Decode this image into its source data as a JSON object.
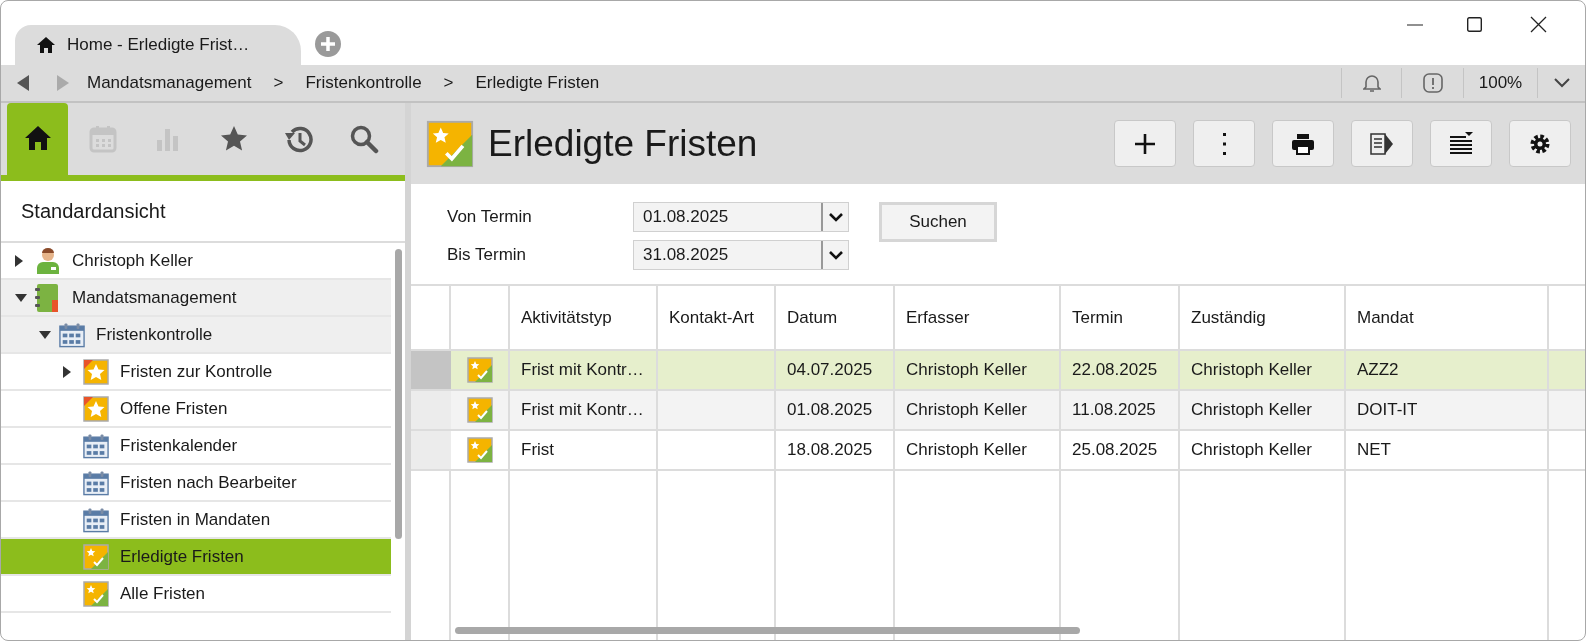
{
  "window": {
    "tab_title": "Home - Erledigte Frist…"
  },
  "breadcrumb": {
    "back_disabled": false,
    "forward_disabled": true,
    "items": [
      "Mandatsmanagement",
      "Fristenkontrolle",
      "Erledigte Fristen"
    ],
    "separator": ">",
    "zoom": "100%"
  },
  "sidebar": {
    "tabs": [
      {
        "kind": "home",
        "selected": true,
        "disabled": false
      },
      {
        "kind": "calendar",
        "selected": false,
        "disabled": true
      },
      {
        "kind": "chart",
        "selected": false,
        "disabled": true
      },
      {
        "kind": "star",
        "selected": false,
        "disabled": false
      },
      {
        "kind": "history",
        "selected": false,
        "disabled": false
      },
      {
        "kind": "search",
        "selected": false,
        "disabled": false
      }
    ],
    "view_title": "Standardansicht",
    "tree": [
      {
        "label": "Christoph Keller",
        "kind": "person",
        "expanded": false,
        "selected": false
      },
      {
        "label": "Mandatsmanagement",
        "kind": "binder",
        "expanded": true,
        "selected": false,
        "children": [
          {
            "label": "Fristenkontrolle",
            "kind": "calendar",
            "expanded": true,
            "selected": false,
            "children": [
              {
                "label": "Fristen zur Kontrolle",
                "kind": "open",
                "expanded": false,
                "selected": false
              },
              {
                "label": "Offene Fristen",
                "kind": "open",
                "selected": false
              },
              {
                "label": "Fristenkalender",
                "kind": "calendar",
                "selected": false
              },
              {
                "label": "Fristen nach Bearbeiter",
                "kind": "calendar",
                "selected": false
              },
              {
                "label": "Fristen in Mandaten",
                "kind": "calendar",
                "selected": false
              },
              {
                "label": "Erledigte Fristen",
                "kind": "done",
                "selected": true
              },
              {
                "label": "Alle Fristen",
                "kind": "done",
                "selected": false
              }
            ]
          }
        ]
      }
    ]
  },
  "main": {
    "title": "Erledigte Fristen",
    "toolbar": [
      {
        "kind": "plus"
      },
      {
        "kind": "more"
      },
      {
        "kind": "print"
      },
      {
        "kind": "panel"
      },
      {
        "kind": "list"
      },
      {
        "kind": "settings"
      }
    ],
    "filters": [
      {
        "label": "Von Termin",
        "value": "01.08.2025"
      },
      {
        "label": "Bis Termin",
        "value": "31.08.2025"
      }
    ],
    "search_button": "Suchen",
    "table": {
      "columns": [
        "Aktivitätstyp",
        "Kontakt-Art",
        "Datum",
        "Erfasser",
        "Termin",
        "Zuständig",
        "Mandat"
      ],
      "rows": [
        {
          "selected": true,
          "cells": [
            "Frist mit Kontr…",
            "",
            "04.07.2025",
            "Christoph Keller",
            "22.08.2025",
            "Christoph Keller",
            "AZZ2"
          ]
        },
        {
          "selected": false,
          "cells": [
            "Frist mit Kontr…",
            "",
            "01.08.2025",
            "Christoph Keller",
            "11.08.2025",
            "Christoph Keller",
            "DOIT-IT"
          ]
        },
        {
          "selected": false,
          "cells": [
            "Frist",
            "",
            "18.08.2025",
            "Christoph Keller",
            "25.08.2025",
            "Christoph Keller",
            "NET"
          ]
        }
      ]
    }
  }
}
